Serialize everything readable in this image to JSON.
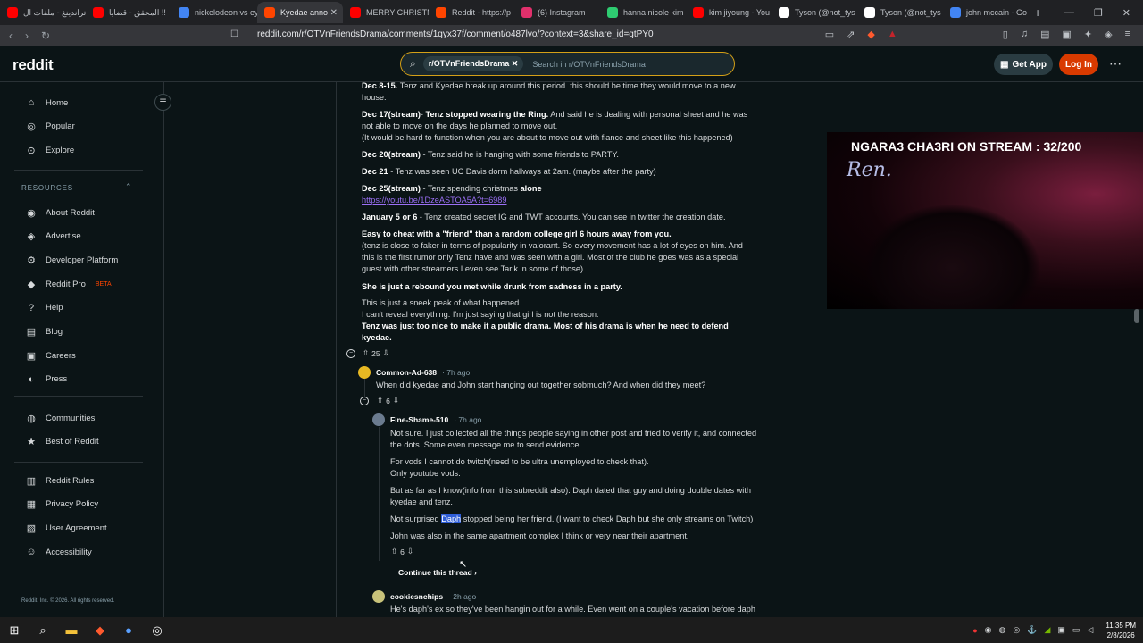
{
  "browser": {
    "tabs": [
      {
        "label": "تراندينغ - ملفات ال",
        "color": "#ff0000"
      },
      {
        "label": "المحقق - قضايا !!",
        "color": "#ff0000"
      },
      {
        "label": "nickelodeon vs ey",
        "color": "#4285f4"
      },
      {
        "label": "Kyedae anno",
        "color": "#ff4500",
        "active": true
      },
      {
        "label": "MERRY CHRISTM",
        "color": "#ff0000"
      },
      {
        "label": "Reddit - https://p",
        "color": "#ff4500"
      },
      {
        "label": "(6) Instagram",
        "color": "#e1306c"
      },
      {
        "label": "hanna nicole kim",
        "color": "#2ecc71"
      },
      {
        "label": "kim jiyoung - You",
        "color": "#ff0000"
      },
      {
        "label": "Tyson (@not_tys",
        "color": "#ffffff"
      },
      {
        "label": "Tyson (@not_tys",
        "color": "#ffffff"
      },
      {
        "label": "john mccain - Go",
        "color": "#4285f4"
      }
    ],
    "url": "reddit.com/r/OTVnFriendsDrama/comments/1qyx37f/comment/o487lvo/?context=3&share_id=gtPY0"
  },
  "header": {
    "logo": "reddit",
    "search_chip": "r/OTVnFriendsDrama",
    "search_placeholder": "Search in r/OTVnFriendsDrama",
    "get_app": "Get App",
    "login": "Log In"
  },
  "sidebar": {
    "top": [
      {
        "label": "Home",
        "icon": "home-icon",
        "glyph": "⌂"
      },
      {
        "label": "Popular",
        "icon": "popular-icon",
        "glyph": "◎"
      },
      {
        "label": "Explore",
        "icon": "explore-icon",
        "glyph": "⊙"
      }
    ],
    "resources_heading": "RESOURCES",
    "resources": [
      {
        "label": "About Reddit",
        "icon": "about-icon",
        "glyph": "◉"
      },
      {
        "label": "Advertise",
        "icon": "advertise-icon",
        "glyph": "◈"
      },
      {
        "label": "Developer Platform",
        "icon": "developer-icon",
        "glyph": "⚙"
      },
      {
        "label": "Reddit Pro",
        "icon": "pro-icon",
        "glyph": "◆",
        "badge": "BETA"
      },
      {
        "label": "Help",
        "icon": "help-icon",
        "glyph": "?"
      },
      {
        "label": "Blog",
        "icon": "blog-icon",
        "glyph": "▤"
      },
      {
        "label": "Careers",
        "icon": "careers-icon",
        "glyph": "▣"
      },
      {
        "label": "Press",
        "icon": "press-icon",
        "glyph": "◐"
      }
    ],
    "community": [
      {
        "label": "Communities",
        "icon": "communities-icon",
        "glyph": "◍"
      },
      {
        "label": "Best of Reddit",
        "icon": "best-icon",
        "glyph": "★"
      }
    ],
    "legal": [
      {
        "label": "Reddit Rules",
        "icon": "rules-icon",
        "glyph": "▥"
      },
      {
        "label": "Privacy Policy",
        "icon": "privacy-icon",
        "glyph": "▦"
      },
      {
        "label": "User Agreement",
        "icon": "agreement-icon",
        "glyph": "▧"
      },
      {
        "label": "Accessibility",
        "icon": "accessibility-icon",
        "glyph": "☺"
      }
    ],
    "copyright": "Reddit, Inc. © 2026. All rights reserved."
  },
  "post": {
    "l1_b": "Dec 8-15.",
    "l1_t": " Tenz and Kyedae break up around this period. this should be time they would move to a new house.",
    "l2_b1": "Dec 17(stream)",
    "l2_t1": "- ",
    "l2_b2": "Tenz stopped wearing the Ring.",
    "l2_t2": " And said he is dealing with personal sheet and he was not able to move on the days he planned to move out.",
    "l2_t3": "(It would be hard to function when you are about to move out with fiance and sheet like this happened)",
    "l3_b": "Dec 20(stream)",
    "l3_t": " - Tenz said he is hanging with some friends to PARTY.",
    "l4_b": "Dec 21",
    "l4_t": " - Tenz was seen UC Davis dorm hallways at 2am. (maybe after the party)",
    "l5_b": "Dec 25(stream)",
    "l5_t": " - Tenz spending christmas ",
    "l5_b2": "alone",
    "l5_link": "https://youtu.be/1DzeASTOA5A?t=6989",
    "l6_b": "January 5 or 6",
    "l6_t": " - Tenz created secret IG and TWT accounts. You can see in twitter the creation date.",
    "l7_b": "Easy to cheat with a \"friend\" than a random college girl 6 hours away from you.",
    "l7_t": "(tenz is close to faker in terms of popularity in valorant. So every movement has a lot of eyes on him. And this is the first rumor only Tenz have and was seen with a girl. Most of the club he goes was as a special guest with other streamers I even see Tarik in some of those)",
    "l8_b": "She is just a rebound you met while drunk from sadness in a party.",
    "l9_t1": "This is just a sneek peak of what happened.",
    "l9_t2": "I can't reveal everything. I'm just saying that girl is not the reason.",
    "l9_b": "Tenz was just too nice to make it a public drama. Most of his drama is when he need to defend kyedae.",
    "votes": "25"
  },
  "comments": [
    {
      "user": "Common-Ad-638",
      "time": "7h ago",
      "text": "When did kyedae and John start hanging out together sobmuch? And when did they meet?",
      "votes": "6"
    },
    {
      "user": "Fine-Shame-510",
      "time": "7h ago",
      "p1": "Not sure. I just collected all the things people saying in other post and tried to verify it, and connected the dots. Some even message me to send evidence.",
      "p2a": "For vods I cannot do twitch(need to be ultra unemployed to check that).",
      "p2b": "Only youtube vods.",
      "p3": "But as far as I know(info from this subreddit also). Daph dated that guy and doing double dates with kyedae and tenz.",
      "p4a": "Not surprised ",
      "p4hl": "Daph",
      "p4b": " stopped being her friend. (I want to check Daph but she only streams on Twitch)",
      "p5": "John was also in the same apartment complex I think or very near their apartment.",
      "votes": "6"
    },
    {
      "user": "cookiesnchips",
      "time": "2h ago",
      "text": "He's daph's ex so they've been hangin out for a while. Even went on a couple's vacation before daph"
    }
  ],
  "continue_thread": "Continue this thread",
  "stream": {
    "title": "NGARA3 CHA3RI ON STREAM : 32/200",
    "signature": "Ren."
  },
  "taskbar": {
    "time": "11:35 PM",
    "date": "2/8/2026"
  },
  "colors": {
    "accent": "#ff4500",
    "login": "#d93a00",
    "search_border": "#d4a017",
    "link": "#9b6ff5"
  }
}
